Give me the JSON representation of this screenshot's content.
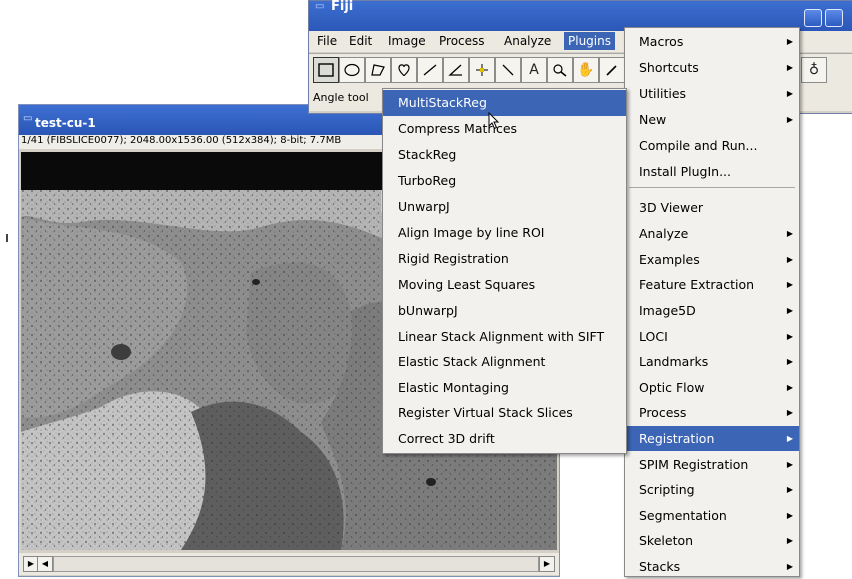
{
  "fiji": {
    "title": "Fiji",
    "menus": [
      "File",
      "Edit",
      "Image",
      "Process",
      "Analyze",
      "Plugins"
    ],
    "active_menu": "Plugins",
    "status": "Angle tool",
    "tools": [
      "rectangle-icon",
      "oval-icon",
      "polygon-icon",
      "freehand-icon",
      "line-icon",
      "angle-icon",
      "point-icon",
      "wand-icon",
      "text-icon",
      "magnifier-icon",
      "hand-icon",
      "dropper-icon",
      "paint-icon"
    ]
  },
  "image_window": {
    "title": "test-cu-1",
    "info": "1/41 (FIBSLICE0077); 2048.00x1536.00  (512x384); 8-bit; 7.7MB"
  },
  "plugins_menu": {
    "items": [
      {
        "label": "Macros",
        "submenu": true
      },
      {
        "label": "Shortcuts",
        "submenu": true
      },
      {
        "label": "Utilities",
        "submenu": true
      },
      {
        "label": "New",
        "submenu": true
      },
      {
        "label": "Compile and Run...",
        "submenu": false
      },
      {
        "label": "Install PlugIn...",
        "submenu": false
      },
      {
        "label": "3D Viewer",
        "submenu": false
      },
      {
        "label": "Analyze",
        "submenu": true
      },
      {
        "label": "Examples",
        "submenu": true
      },
      {
        "label": "Feature Extraction",
        "submenu": true
      },
      {
        "label": "Image5D",
        "submenu": true
      },
      {
        "label": "LOCI",
        "submenu": true
      },
      {
        "label": "Landmarks",
        "submenu": true
      },
      {
        "label": "Optic Flow",
        "submenu": true
      },
      {
        "label": "Process",
        "submenu": true
      },
      {
        "label": "Registration",
        "submenu": true
      },
      {
        "label": "SPIM Registration",
        "submenu": true
      },
      {
        "label": "Scripting",
        "submenu": true
      },
      {
        "label": "Segmentation",
        "submenu": true
      },
      {
        "label": "Skeleton",
        "submenu": true
      },
      {
        "label": "Stacks",
        "submenu": true
      }
    ],
    "highlighted": "Registration"
  },
  "registration_submenu": {
    "items": [
      "MultiStackReg",
      "Compress Matrices",
      "StackReg",
      "TurboReg",
      "UnwarpJ",
      "Align Image by line ROI",
      "Rigid Registration",
      "Moving Least Squares",
      "bUnwarpJ",
      "Linear Stack Alignment with SIFT",
      "Elastic Stack Alignment",
      "Elastic Montaging",
      "Register Virtual Stack Slices",
      "Correct 3D drift"
    ],
    "highlighted": "MultiStackReg"
  },
  "colors": {
    "title_blue": "#2b57b8",
    "menu_highlight": "#3c65b5",
    "menu_bg": "#f2f1ed",
    "window_bg": "#d4d0c8"
  }
}
